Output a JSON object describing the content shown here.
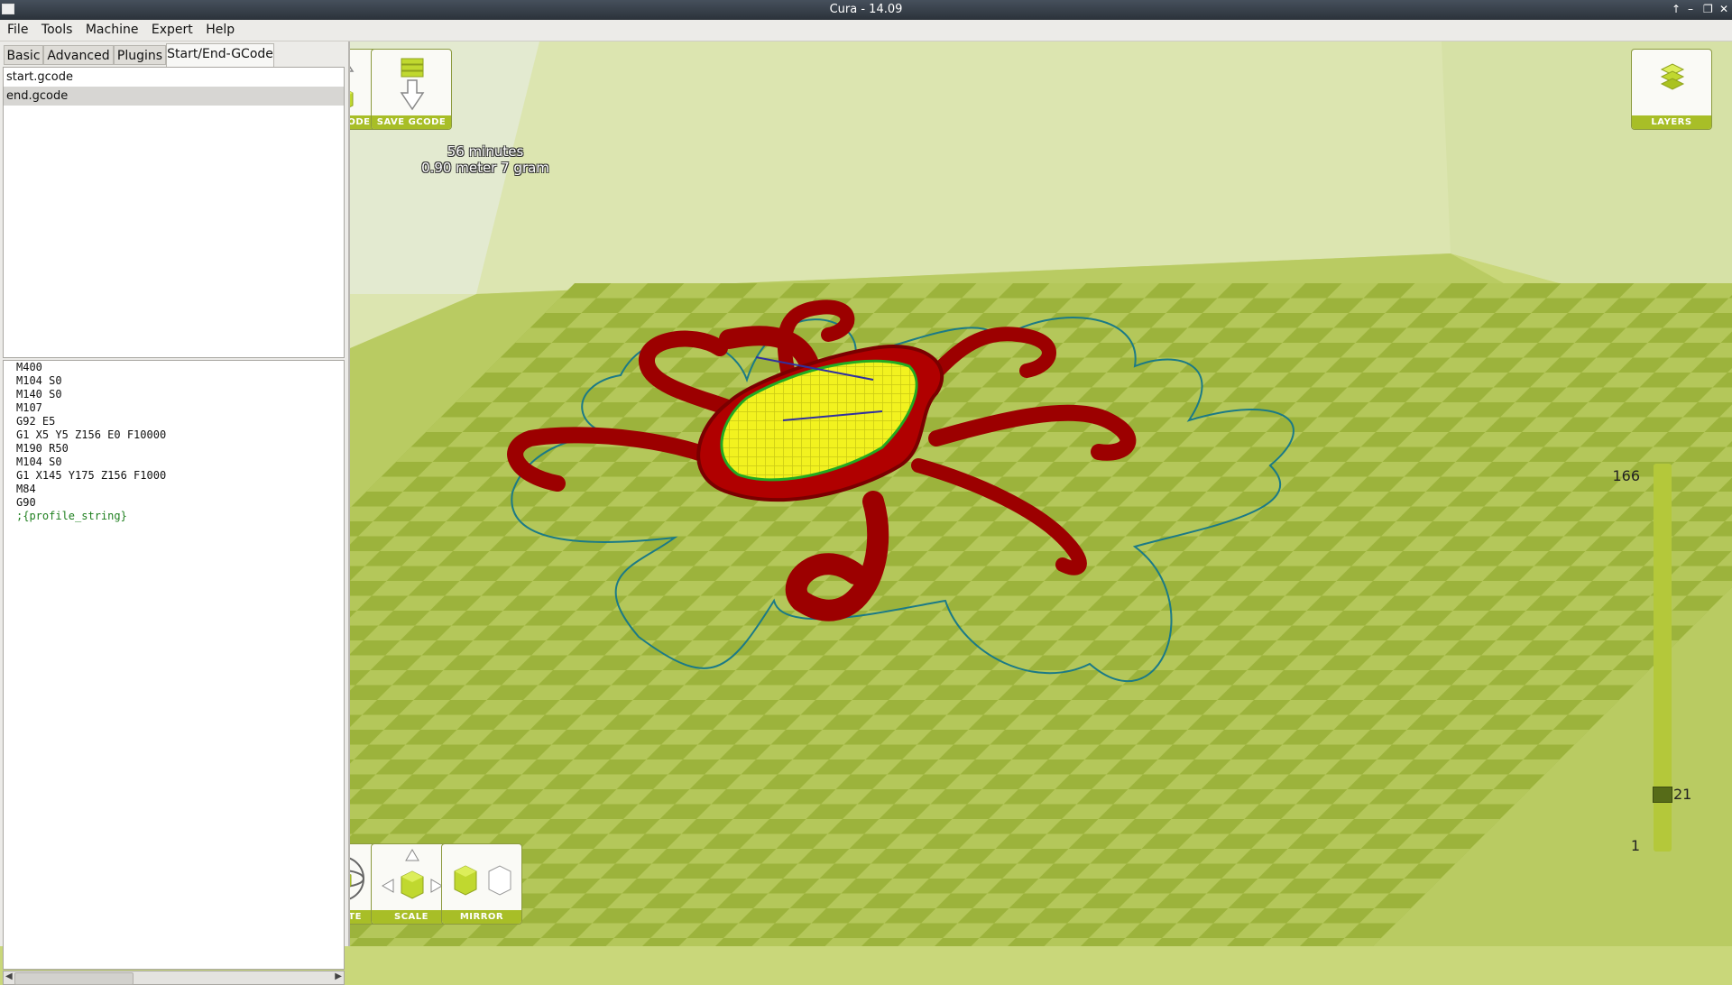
{
  "window": {
    "title": "Cura - 14.09"
  },
  "menu": [
    "File",
    "Tools",
    "Machine",
    "Expert",
    "Help"
  ],
  "tabs": [
    "Basic",
    "Advanced",
    "Plugins",
    "Start/End-GCode"
  ],
  "files": [
    "start.gcode",
    "end.gcode"
  ],
  "gcode_lines": [
    "M400",
    "M104 S0",
    "M140 S0",
    "M107",
    "G92 E5",
    "G1 X5 Y5 Z156 E0 F10000",
    "M190 R50",
    "M104 S0",
    "G1 X145 Y175 Z156 F1000",
    "M84",
    "G90",
    ";{profile_string}"
  ],
  "toolbar": {
    "load_model": "LOAD MODEL",
    "save_gcode": "SAVE GCODE",
    "layers": "LAYERS",
    "rotate": "ROTATE",
    "scale": "SCALE",
    "mirror": "MIRROR"
  },
  "print_info": {
    "time": "56 minutes",
    "material": "0.90 meter 7 gram"
  },
  "layer_slider": {
    "max": "166",
    "current": "21",
    "min": "1",
    "current_level": 21,
    "max_level": 166
  },
  "colors": {
    "accent": "#a8be27",
    "model_red": "#9c0000",
    "infill_yellow": "#f2f21f",
    "skirt": "#1b7a86"
  }
}
